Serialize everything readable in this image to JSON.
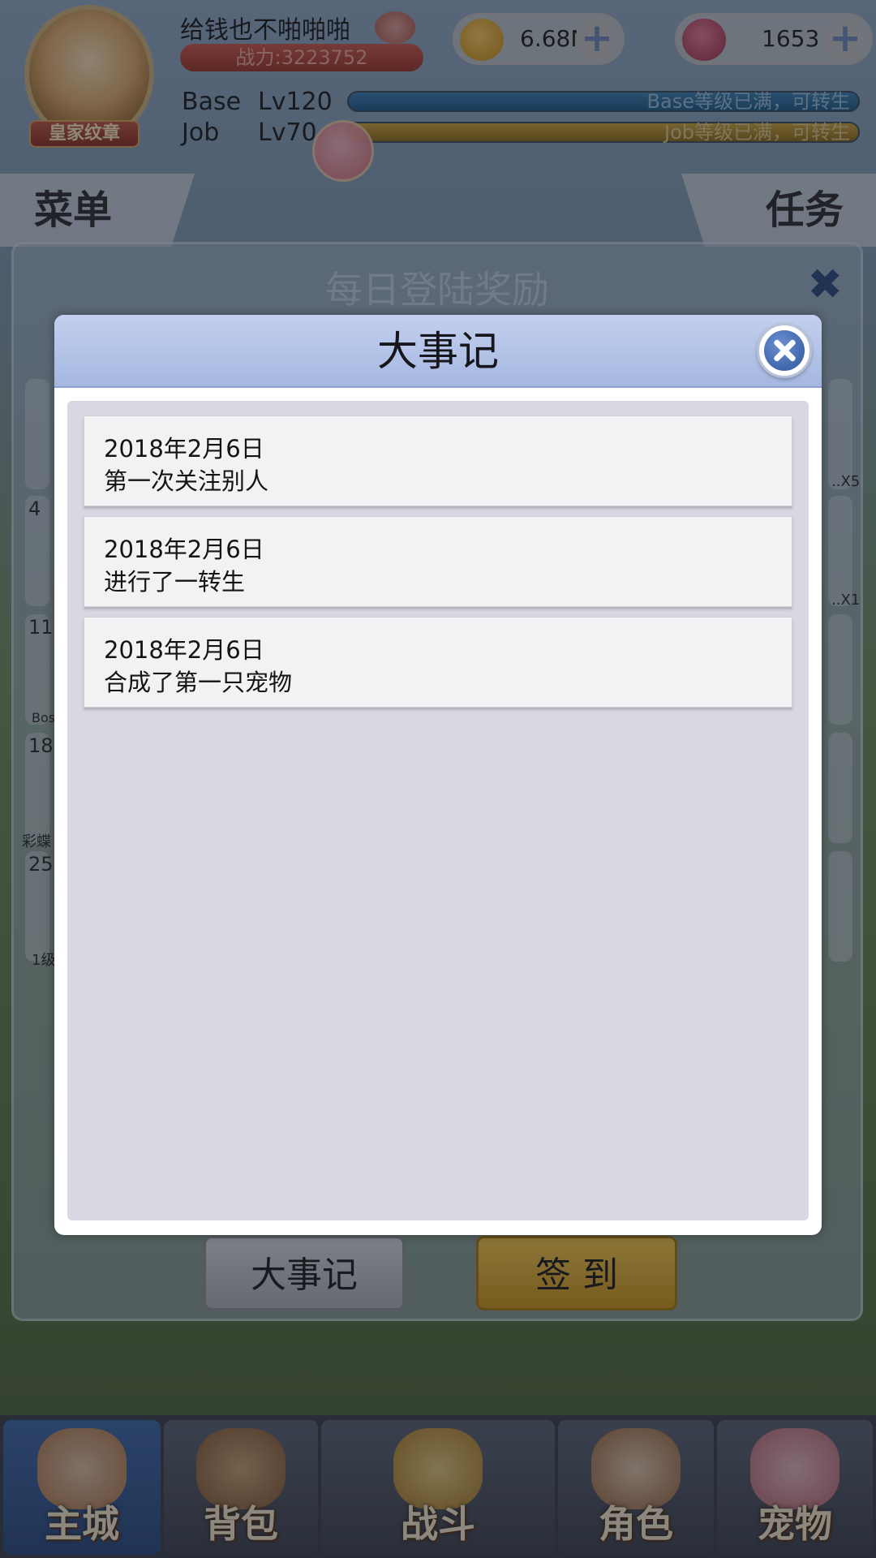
{
  "hud": {
    "player_name": "给钱也不啪啪啪",
    "avatar_badge": "皇家纹章",
    "power": "战力:3223752",
    "currency_zeny": "6.68M",
    "currency_gems": "1653",
    "base_label": "Base",
    "base_level": "Lv120",
    "base_status": "Base等级已满，可转生",
    "job_label": "Job",
    "job_level": "Lv70",
    "job_status": "Job等级已满，可转生"
  },
  "side_tabs": {
    "menu": "菜单",
    "tasks": "任务"
  },
  "daily_panel": {
    "title": "每日登陆奖励",
    "cells": [
      "4",
      "11",
      "18",
      "25"
    ],
    "cell_notes": [
      "Bos",
      "彩蝶",
      "1级"
    ],
    "right_counts": [
      "..X5",
      "..X1"
    ],
    "history_button": "大事记",
    "signin_button": "签 到"
  },
  "modal": {
    "title": "大事记",
    "events": [
      {
        "date": "2018年2月6日",
        "text": "第一次关注别人"
      },
      {
        "date": "2018年2月6日",
        "text": "进行了一转生"
      },
      {
        "date": "2018年2月6日",
        "text": "合成了第一只宠物"
      }
    ]
  },
  "bottom_nav": {
    "items": [
      {
        "label": "主城",
        "icon": "castle-icon"
      },
      {
        "label": "背包",
        "icon": "backpack-icon"
      },
      {
        "label": "战斗",
        "icon": "battle-wheel-icon"
      },
      {
        "label": "角色",
        "icon": "character-icon"
      },
      {
        "label": "宠物",
        "icon": "pet-poring-icon"
      }
    ],
    "active_index": 0
  },
  "colors": {
    "modal_header": "#a5b7e0",
    "close_button": "#2f569c",
    "signin_button": "#f0c24a",
    "nav_active": "#3f66a3"
  }
}
